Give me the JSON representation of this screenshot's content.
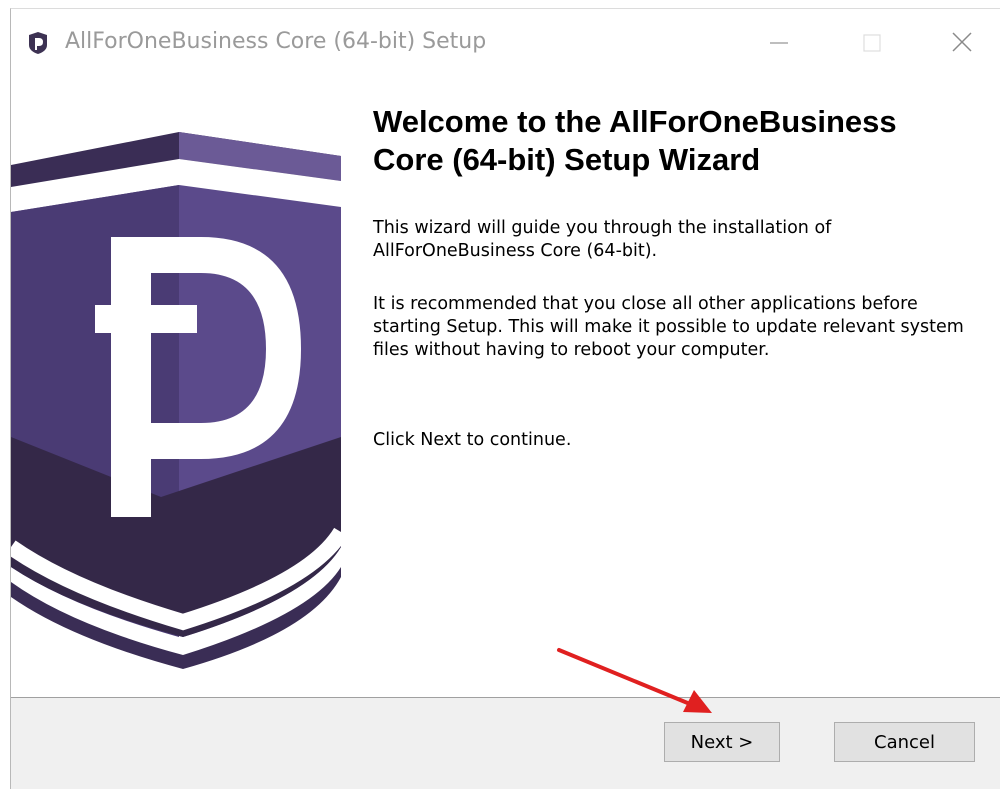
{
  "window": {
    "title": "AllForOneBusiness Core (64-bit) Setup",
    "icon": "pivx-shield-icon",
    "controls": [
      "minimize-icon",
      "maximize-icon",
      "close-icon"
    ]
  },
  "sidebar": {
    "logo": "pivx-shield-logo"
  },
  "content": {
    "heading": "Welcome to the AllForOneBusiness Core (64-bit) Setup Wizard",
    "paragraphs": [
      "This wizard will guide you through the installation of AllForOneBusiness Core (64-bit).",
      "It is recommended that you close all other applications before starting Setup. This will make it possible to update relevant system files without having to reboot your computer.",
      "Click Next to continue."
    ]
  },
  "footer": {
    "next_label": "Next >",
    "cancel_label": "Cancel"
  },
  "colors": {
    "brand_purple": "#5b4a8b",
    "brand_dark": "#3a2d55",
    "annotation_arrow": "#e02020"
  }
}
